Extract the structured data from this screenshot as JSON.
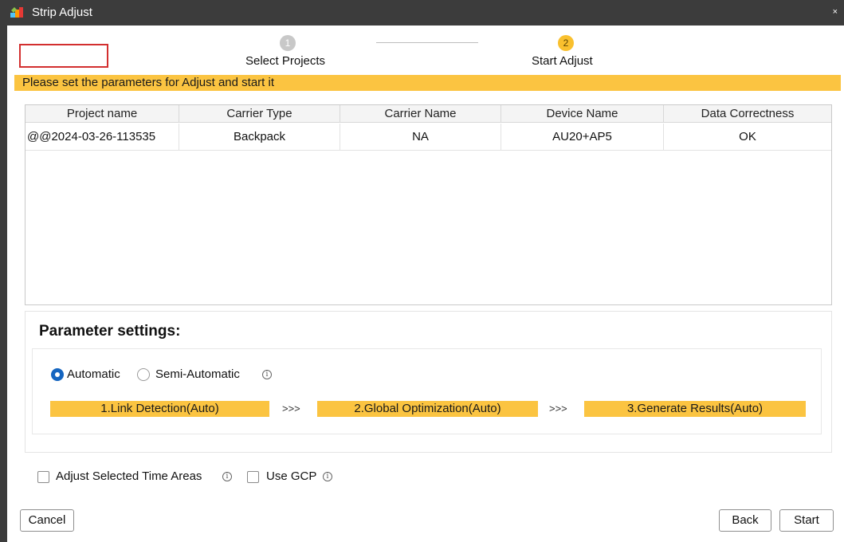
{
  "window": {
    "title": "Strip Adjust",
    "close_glyph": "×"
  },
  "stepper": {
    "steps": [
      {
        "number": "1",
        "label": "Select Projects",
        "state": "done"
      },
      {
        "number": "2",
        "label": "Start Adjust",
        "state": "active"
      }
    ]
  },
  "banner": {
    "text": "Please set the parameters for Adjust and start it"
  },
  "table": {
    "columns": [
      "Project name",
      "Carrier Type",
      "Carrier Name",
      "Device Name",
      "Data Correctness"
    ],
    "rows": [
      [
        "@@2024-03-26-113535",
        "Backpack",
        "NA",
        "AU20+AP5",
        "OK"
      ]
    ]
  },
  "params": {
    "title": "Parameter settings:",
    "mode_options": [
      {
        "label": "Automatic",
        "selected": true
      },
      {
        "label": "Semi-Automatic",
        "selected": false
      }
    ],
    "info_glyph": "i",
    "flow_steps": [
      "1.Link Detection(Auto)",
      "2.Global Optimization(Auto)",
      "3.Generate Results(Auto)"
    ],
    "flow_separator": ">>>"
  },
  "options": {
    "adjust_time_areas": {
      "label": "Adjust Selected Time Areas",
      "checked": false
    },
    "use_gcp": {
      "label": "Use GCP",
      "checked": false
    }
  },
  "footer": {
    "cancel_label": "Cancel",
    "back_label": "Back",
    "start_label": "Start"
  },
  "colors": {
    "accent": "#fbc441",
    "active_step": "#f9c02e",
    "radio_selected": "#1565c0",
    "highlight_box": "#d32f2f",
    "titlebar": "#3c3c3c"
  },
  "icons": {
    "app": "strip-adjust-app-icon",
    "info": "info-circle-icon",
    "close": "close-icon"
  }
}
